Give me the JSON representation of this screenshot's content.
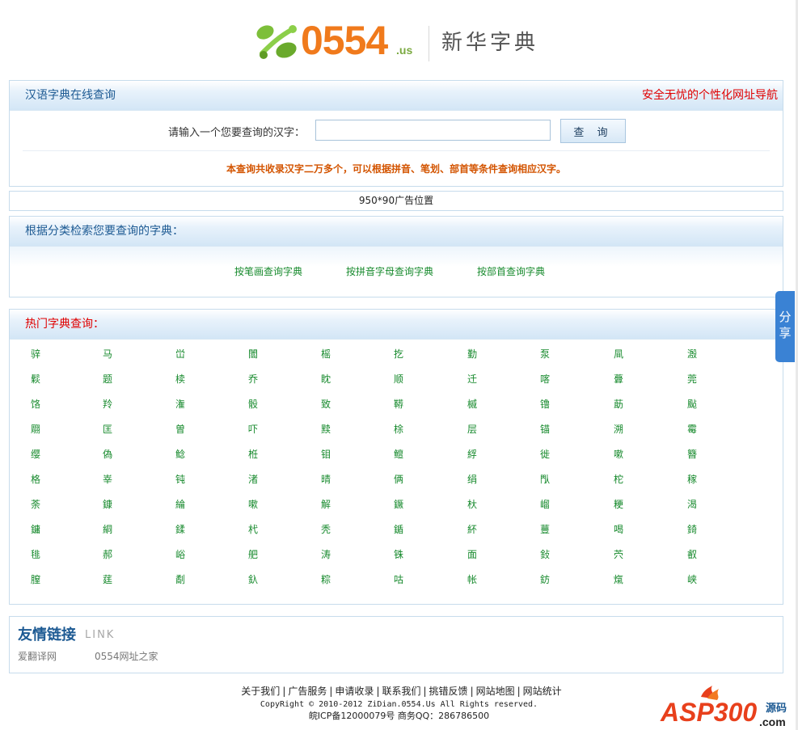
{
  "header": {
    "logo_number": "0554",
    "logo_suffix": ".us",
    "logo_title": "新华字典"
  },
  "search": {
    "title": "汉语字典在线查询",
    "right_link": "安全无忧的个性化网址导航",
    "label": "请输入一个您要查询的汉字：",
    "input_value": "",
    "button_label": "查 询",
    "note": "本查询共收录汉字二万多个，可以根据拼音、笔划、部首等条件查询相应汉字。"
  },
  "ad": {
    "text": "950*90广告位置"
  },
  "categories": {
    "title": "根据分类检索您要查询的字典：",
    "links": [
      "按笔画查询字典",
      "按拼音字母查询字典",
      "按部首查询字典"
    ]
  },
  "hot": {
    "title": "热门字典查询：",
    "rows": [
      [
        "骍",
        "马",
        "峃",
        "闟",
        "榣",
        "扢",
        "勤",
        "泵",
        "凬",
        "溵"
      ],
      [
        "鬏",
        "题",
        "椟",
        "乔",
        "眈",
        "顺",
        "迁",
        "喀",
        "虋",
        "莞"
      ],
      [
        "饹",
        "羚",
        "潅",
        "骰",
        "致",
        "鞯",
        "槭",
        "镥",
        "莇",
        "颭"
      ],
      [
        "翢",
        "匡",
        "曽",
        "吓",
        "黩",
        "梌",
        "层",
        "锚",
        "溯",
        "霉"
      ],
      [
        "缨",
        "偽",
        "鲶",
        "栣",
        "钼",
        "鳣",
        "綒",
        "徙",
        "嗽",
        "簪"
      ],
      [
        "格",
        "峷",
        "钝",
        "渚",
        "晴",
        "俩",
        "绢",
        "閄",
        "柁",
        "稼"
      ],
      [
        "荼",
        "鏮",
        "綸",
        "嗽",
        "解",
        "鐝",
        "杕",
        "嵧",
        "粳",
        "渴"
      ],
      [
        "鏞",
        "絧",
        "鍒",
        "杙",
        "秃",
        "鍎",
        "紑",
        "蘴",
        "喝",
        "錡"
      ],
      [
        "毴",
        "郝",
        "峪",
        "舥",
        "涛",
        "铢",
        "面",
        "鈙",
        "茓",
        "叡"
      ],
      [
        "膣",
        "莛",
        "劀",
        "釞",
        "粽",
        "咕",
        "帐",
        "鈁",
        "熂",
        "峡"
      ]
    ]
  },
  "friends": {
    "title": "友情链接",
    "title_en": "LINK",
    "links": [
      "爱翻译网",
      "0554网址之家"
    ]
  },
  "footer": {
    "nav": [
      "关于我们",
      "广告服务",
      "申请收录",
      "联系我们",
      "挑错反馈",
      "网站地图",
      "网站统计"
    ],
    "separator": "|",
    "copyright": "CopyRight © 2010-2012 ZiDian.0554.Us All Rights reserved.",
    "icp": "皖ICP备12000079号 商务QQ：286786500"
  },
  "share": {
    "label_1": "分",
    "label_2": "享"
  },
  "watermark": {
    "text_main": "ASP300",
    "text_cn": "源码",
    "text_com": ".com"
  },
  "colors": {
    "accent_blue": "#1d5a93",
    "link_green": "#178a2d",
    "alert_red": "#e00000",
    "note_orange": "#d35400",
    "logo_orange": "#f07a1c"
  }
}
